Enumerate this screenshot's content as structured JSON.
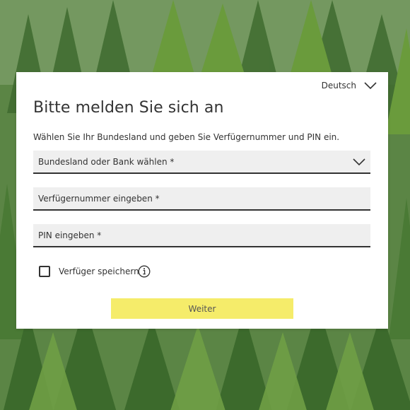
{
  "language_selector": {
    "selected": "Deutsch",
    "icon": "chevron-down-icon"
  },
  "login": {
    "title": "Bitte melden Sie sich an",
    "instructions": "Wählen Sie Ihr Bundesland und geben Sie Verfügernummer und PIN ein.",
    "bank_select": {
      "label": "Bundesland oder Bank wählen *",
      "icon": "chevron-down-icon"
    },
    "verfueger_field": {
      "label": "Verfügernummer eingeben *"
    },
    "pin_field": {
      "label": "PIN eingeben *"
    },
    "remember": {
      "label": "Verfüger speichern",
      "checked": false,
      "info_icon": "info-icon"
    },
    "submit_label": "Weiter"
  },
  "colors": {
    "card_background": "#ffffff",
    "field_background": "#efefef",
    "field_underline": "#333333",
    "submit_button": "#f5ec6a",
    "text": "#333333"
  }
}
